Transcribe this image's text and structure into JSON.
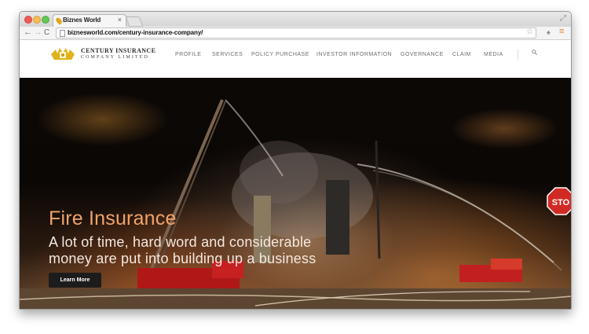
{
  "browser": {
    "tab_title": "Biznes World",
    "tab_close": "×",
    "url": "biznesworld.com/century-insurance-company/",
    "icons": [
      "back-arrow-icon",
      "forward-arrow-icon",
      "reload-icon",
      "page-icon",
      "star-icon",
      "extension-icon",
      "menu-icon"
    ]
  },
  "nav_glyphs": {
    "back": "←",
    "forward": "→",
    "reload": "C",
    "star": "☆",
    "ext": "♠",
    "menu": "≡",
    "expand": "⤢"
  },
  "site": {
    "brand_line_1": "CENTURY INSURANCE",
    "brand_line_2": "COMPANY LIMITED",
    "nav": [
      "PROFILE",
      "SERVICES",
      "POLICY PURCHASE",
      "INVESTOR INFORMATION",
      "GOVERNANCE",
      "CLAIM",
      "MEDIA"
    ]
  },
  "hero": {
    "title": "Fire Insurance",
    "subtitle_line_1": "A lot of time, hard word and considerable",
    "subtitle_line_2": "money are put into building up a business",
    "button_label": "Learn More",
    "stop_sign_text": "STO"
  },
  "colors": {
    "hero_title": "#f0a36a",
    "brand_gold": "#e0b21c",
    "menu_accent": "#e67e22"
  }
}
